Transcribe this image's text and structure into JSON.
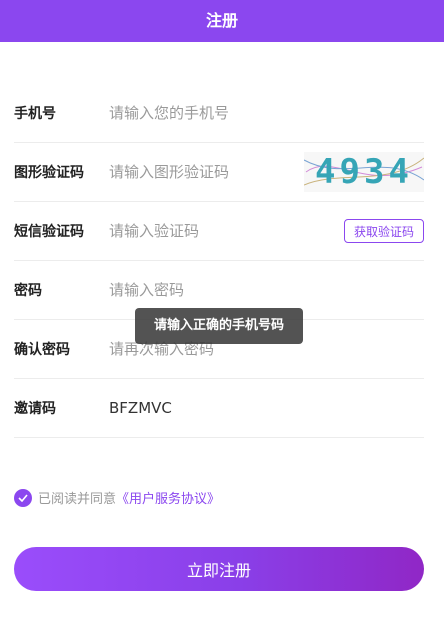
{
  "header": {
    "title": "注册"
  },
  "form": {
    "phone": {
      "label": "手机号",
      "placeholder": "请输入您的手机号"
    },
    "captcha": {
      "label": "图形验证码",
      "placeholder": "请输入图形验证码",
      "image_text": "4934"
    },
    "sms": {
      "label": "短信验证码",
      "placeholder": "请输入验证码",
      "button": "获取验证码"
    },
    "password": {
      "label": "密码",
      "placeholder": "请输入密码"
    },
    "confirm_password": {
      "label": "确认密码",
      "placeholder": "请再次输入密码"
    },
    "invite": {
      "label": "邀请码",
      "value": "BFZMVC"
    }
  },
  "toast": {
    "message": "请输入正确的手机号码"
  },
  "agreement": {
    "prefix": "已阅读并同意",
    "link": "《用户服务协议》",
    "checked": true
  },
  "submit": {
    "label": "立即注册"
  },
  "colors": {
    "accent": "#8b47ef",
    "header": "#8b47ef"
  }
}
